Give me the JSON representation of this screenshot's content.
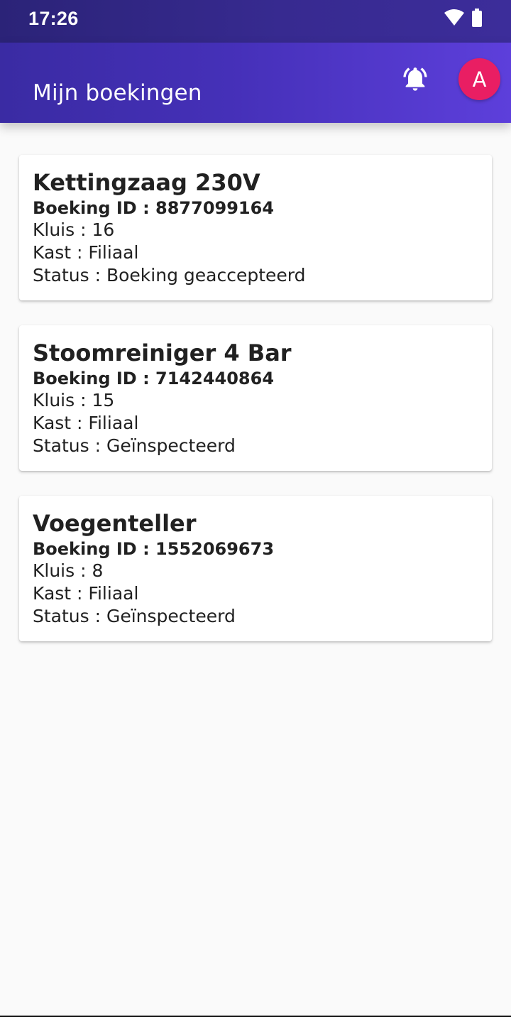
{
  "status_bar": {
    "time": "17:26"
  },
  "app_bar": {
    "title": "Mijn boekingen",
    "avatar_letter": "A",
    "avatar_color": "#e91e63"
  },
  "labels": {
    "booking_id": "Boeking ID : ",
    "kluis": "Kluis : ",
    "kast": "Kast : ",
    "status": "Status : "
  },
  "bookings": [
    {
      "title": "Kettingzaag 230V",
      "booking_id": "8877099164",
      "kluis": "16",
      "kast": "Filiaal",
      "status": "Boeking geaccepteerd"
    },
    {
      "title": "Stoomreiniger 4 Bar",
      "booking_id": "7142440864",
      "kluis": "15",
      "kast": "Filiaal",
      "status": "Geïnspecteerd"
    },
    {
      "title": "Voegenteller",
      "booking_id": "1552069673",
      "kluis": "8",
      "kast": "Filiaal",
      "status": "Geïnspecteerd"
    }
  ]
}
